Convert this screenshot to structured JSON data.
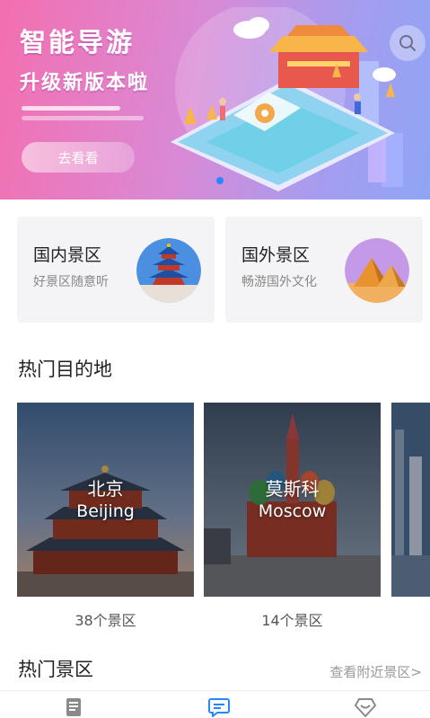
{
  "banner": {
    "headline": "智能导游",
    "subline": "升级新版本啦",
    "button_label": "去看看",
    "icons": [
      "search-icon"
    ]
  },
  "categories": [
    {
      "title": "国内景区",
      "subtitle": "好景区随意听",
      "icon": "temple-of-heaven-image"
    },
    {
      "title": "国外景区",
      "subtitle": "畅游国外文化",
      "icon": "pyramids-image"
    }
  ],
  "hot_destinations": {
    "title": "热门目的地",
    "items": [
      {
        "name_cn": "北京",
        "name_en": "Beijing",
        "count": "38个景区"
      },
      {
        "name_cn": "莫斯科",
        "name_en": "Moscow",
        "count": "14个景区"
      }
    ]
  },
  "hot_spots": {
    "title": "热门景区",
    "more_label": "查看附近景区>"
  },
  "tabbar": {
    "icons": [
      "book-icon",
      "message-icon",
      "favorite-icon"
    ],
    "active_color": "#2a86ff",
    "inactive_color": "#8a8a8a"
  },
  "colors": {
    "accent": "#2a86ff",
    "banner_start": "#f36fb0",
    "banner_end": "#8fa5f4"
  }
}
